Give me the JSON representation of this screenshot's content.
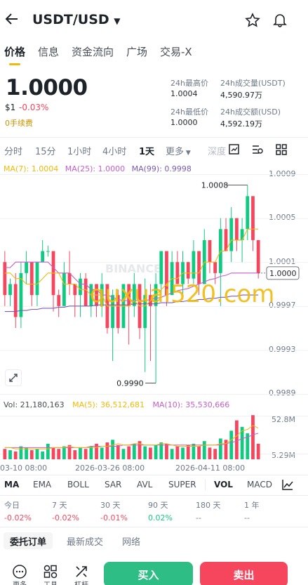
{
  "header": {
    "title": "USDT/USD"
  },
  "tabs": [
    "价格",
    "信息",
    "资金流向",
    "广场",
    "交易-X"
  ],
  "ticker": {
    "price": "1.0000",
    "fiat": "$1",
    "change": "-0.03%",
    "fee": "0手续费",
    "high_label": "24h最高价",
    "high": "1.0004",
    "low_label": "24h最低价",
    "low": "1.0000",
    "vol_label": "24h成交量(USDT)",
    "vol": "4,590.97万",
    "amt_label": "24h成交额(USD)",
    "amt": "4,592.19万"
  },
  "intervals": [
    "分时",
    "15分",
    "1小时",
    "4小时",
    "1天",
    "更多",
    "深度"
  ],
  "ma": {
    "ma7": "MA(7): 1.0004",
    "ma25": "MA(25): 1.0000",
    "ma99": "MA(99): 0.9998"
  },
  "vol_row": {
    "vol": "Vol: 21,180,163",
    "ma5": "MA(5): 36,512,681",
    "ma10": "MA(10): 35,530,666"
  },
  "colors": {
    "up": "#0ecb81",
    "down": "#f6465d",
    "accent": "#f0b90b",
    "ma7": "#f0b90b",
    "ma25": "#c45fc9",
    "ma99": "#7a5bb8"
  },
  "watermark": "BINANCE",
  "overlay_text": "quxuai520.com",
  "chart_data": {
    "type": "candlestick",
    "y_ticks": [
      "1.0009",
      "1.0005",
      "1.0001",
      "0.9997",
      "0.9993",
      "0.9989"
    ],
    "ylim": [
      0.9989,
      1.0009
    ],
    "x_ticks": [
      "03-10 08:00",
      "2026-03-26 08:00",
      "2026-04-11 08:00"
    ],
    "high_label": "1.0008",
    "low_label": "0.9990",
    "last_label": "1.0000",
    "vol_ticks": [
      "52.8M",
      "5.29M"
    ],
    "candles": [
      {
        "o": 1.0001,
        "c": 0.9998,
        "h": 1.0002,
        "l": 0.9997
      },
      {
        "o": 0.9998,
        "c": 0.9999,
        "h": 0.99995,
        "l": 0.9997
      },
      {
        "o": 0.9999,
        "c": 0.9996,
        "h": 1.0,
        "l": 0.9995
      },
      {
        "o": 0.9996,
        "c": 1.0,
        "h": 1.0001,
        "l": 0.9995
      },
      {
        "o": 1.0,
        "c": 1.0001,
        "h": 1.0002,
        "l": 0.9999
      },
      {
        "o": 1.0001,
        "c": 0.9998,
        "h": 1.0001,
        "l": 0.9997
      },
      {
        "o": 0.9998,
        "c": 1.0001,
        "h": 1.0001,
        "l": 0.9997
      },
      {
        "o": 1.0001,
        "c": 1.0002,
        "h": 1.0003,
        "l": 1.0001
      },
      {
        "o": 1.0002,
        "c": 1.0002,
        "h": 1.00025,
        "l": 1.00015
      },
      {
        "o": 1.0002,
        "c": 0.9998,
        "h": 1.0002,
        "l": 0.99965
      },
      {
        "o": 0.9998,
        "c": 0.9997,
        "h": 0.99985,
        "l": 0.9996
      },
      {
        "o": 0.9997,
        "c": 1.0,
        "h": 1.0001,
        "l": 0.9997
      },
      {
        "o": 1.0,
        "c": 0.9999,
        "h": 1.0002,
        "l": 0.9998
      },
      {
        "o": 0.9999,
        "c": 0.9998,
        "h": 0.9999,
        "l": 0.9996
      },
      {
        "o": 0.9998,
        "c": 0.99995,
        "h": 1.0,
        "l": 0.9996
      },
      {
        "o": 0.99995,
        "c": 0.9997,
        "h": 1.0,
        "l": 0.9997
      },
      {
        "o": 0.9997,
        "c": 0.9999,
        "h": 0.9999,
        "l": 0.9996
      },
      {
        "o": 0.9999,
        "c": 0.9997,
        "h": 0.9999,
        "l": 0.9996
      },
      {
        "o": 0.9997,
        "c": 0.9999,
        "h": 1.0,
        "l": 0.9996
      },
      {
        "o": 0.9999,
        "c": 0.9995,
        "h": 0.9999,
        "l": 0.99945
      },
      {
        "o": 0.9995,
        "c": 0.9998,
        "h": 0.99985,
        "l": 0.9992
      },
      {
        "o": 0.9998,
        "c": 0.9995,
        "h": 0.99985,
        "l": 0.99945
      },
      {
        "o": 0.9995,
        "c": 0.9999,
        "h": 0.9999,
        "l": 0.9995
      },
      {
        "o": 0.9999,
        "c": 0.9997,
        "h": 0.9999,
        "l": 0.99935
      },
      {
        "o": 0.9997,
        "c": 0.9999,
        "h": 1.0,
        "l": 0.9996
      },
      {
        "o": 0.9999,
        "c": 0.9995,
        "h": 0.9999,
        "l": 0.9994
      },
      {
        "o": 0.9995,
        "c": 0.9998,
        "h": 0.99995,
        "l": 0.9991
      },
      {
        "o": 0.9998,
        "c": 0.9997,
        "h": 0.9999,
        "l": 0.9992
      },
      {
        "o": 0.9997,
        "c": 0.9999,
        "h": 1.0,
        "l": 0.999
      },
      {
        "o": 0.9999,
        "c": 1.0002,
        "h": 1.0002,
        "l": 0.9998
      },
      {
        "o": 1.0002,
        "c": 0.9998,
        "h": 1.0002,
        "l": 0.9997
      },
      {
        "o": 0.9998,
        "c": 1.0001,
        "h": 1.0002,
        "l": 0.9998
      },
      {
        "o": 1.0001,
        "c": 0.9999,
        "h": 1.0002,
        "l": 0.9999
      },
      {
        "o": 0.9999,
        "c": 1.0001,
        "h": 1.0002,
        "l": 0.9998
      },
      {
        "o": 1.0001,
        "c": 0.99995,
        "h": 1.0001,
        "l": 0.9999
      },
      {
        "o": 0.99995,
        "c": 1.0002,
        "h": 1.0003,
        "l": 0.9999
      },
      {
        "o": 1.0002,
        "c": 0.9999,
        "h": 1.0002,
        "l": 0.9998
      },
      {
        "o": 0.9999,
        "c": 1.0003,
        "h": 1.0004,
        "l": 0.9999
      },
      {
        "o": 1.0003,
        "c": 1.0001,
        "h": 1.0003,
        "l": 1.0
      },
      {
        "o": 1.0001,
        "c": 1.0,
        "h": 1.0001,
        "l": 0.9999
      },
      {
        "o": 1.0,
        "c": 1.0004,
        "h": 1.0005,
        "l": 0.9997
      },
      {
        "o": 1.0004,
        "c": 1.0002,
        "h": 1.0005,
        "l": 1.0002
      },
      {
        "o": 1.0002,
        "c": 1.0005,
        "h": 1.0006,
        "l": 1.0001
      },
      {
        "o": 1.0005,
        "c": 1.0003,
        "h": 1.0005,
        "l": 1.0002
      },
      {
        "o": 1.0003,
        "c": 1.0004,
        "h": 1.0005,
        "l": 1.0001
      },
      {
        "o": 1.0004,
        "c": 1.0007,
        "h": 1.0008,
        "l": 1.0003
      },
      {
        "o": 1.0007,
        "c": 1.0003,
        "h": 1.0007,
        "l": 1.0002
      },
      {
        "o": 1.0003,
        "c": 1.0,
        "h": 1.0003,
        "l": 0.99995
      }
    ],
    "ma7": [
      1.0,
      1.0,
      0.99995,
      0.99995,
      0.9999,
      0.9999,
      0.9999,
      0.99995,
      1.0,
      1.0,
      1.0,
      0.9999,
      0.9999,
      0.9999,
      0.99985,
      0.99985,
      0.9998,
      0.9998,
      0.9998,
      0.9997,
      0.9997,
      0.9997,
      0.9997,
      0.9997,
      0.99975,
      0.9997,
      0.9997,
      0.99975,
      0.9998,
      0.99985,
      0.9999,
      0.99995,
      0.99995,
      1.0,
      1.0,
      1.0,
      1.0,
      1.0001,
      1.0001,
      1.0001,
      1.0002,
      1.0002,
      1.0003,
      1.0003,
      1.0003,
      1.0004,
      1.0004,
      1.0004
    ],
    "ma25": [
      1.00005,
      1.00005,
      1.0001,
      1.0001,
      1.0001,
      1.0001,
      1.0001,
      1.0001,
      1.0001,
      1.00005,
      1.0,
      1.0,
      1.0,
      0.99995,
      0.9999,
      0.9999,
      0.99985,
      0.99985,
      0.9998,
      0.9998,
      0.99978,
      0.99976,
      0.99975,
      0.99975,
      0.99975,
      0.99975,
      0.99975,
      0.99976,
      0.99977,
      0.99978,
      0.9998,
      0.99982,
      0.99984,
      0.99985,
      0.99986,
      0.99988,
      0.9999,
      0.99992,
      0.99994,
      0.99995,
      0.99997,
      0.99998,
      1.0,
      1.0,
      1.0,
      1.0,
      1.0,
      1.0
    ],
    "ma99": [
      0.99965,
      0.99965,
      0.99965,
      0.99966,
      0.99966,
      0.99967,
      0.99967,
      0.99968,
      0.99968,
      0.99968,
      0.99969,
      0.99969,
      0.9997,
      0.9997,
      0.9997,
      0.9997,
      0.9997,
      0.99971,
      0.99971,
      0.99971,
      0.99971,
      0.99971,
      0.99971,
      0.99971,
      0.99972,
      0.99972,
      0.99972,
      0.99972,
      0.99972,
      0.99973,
      0.99973,
      0.99973,
      0.99974,
      0.99974,
      0.99975,
      0.99975,
      0.99976,
      0.99976,
      0.99977,
      0.99977,
      0.99978,
      0.99978,
      0.99979,
      0.99979,
      0.9998,
      0.9998,
      0.9998,
      0.9998
    ],
    "volumes": [
      8,
      7,
      6,
      10,
      9,
      7,
      8,
      6,
      12,
      9,
      8,
      10,
      11,
      7,
      9,
      8,
      10,
      12,
      9,
      13,
      15,
      11,
      8,
      10,
      12,
      14,
      10,
      9,
      11,
      13,
      12,
      8,
      10,
      9,
      11,
      12,
      10,
      14,
      9,
      8,
      16,
      15,
      22,
      30,
      25,
      20,
      34,
      12
    ],
    "vol_ma5": [
      9,
      9,
      8,
      8,
      8,
      8,
      8,
      8,
      8,
      9,
      9,
      9,
      10,
      9,
      9,
      9,
      9,
      9,
      10,
      10,
      11,
      12,
      11,
      11,
      12,
      12,
      11,
      11,
      11,
      12,
      12,
      11,
      10,
      10,
      10,
      10,
      10,
      11,
      11,
      11,
      12,
      12,
      15,
      18,
      22,
      23,
      26,
      24
    ],
    "vol_ma10": [
      9,
      9,
      9,
      9,
      9,
      9,
      9,
      9,
      9,
      9,
      9,
      9,
      9,
      9,
      9,
      9,
      10,
      10,
      10,
      10,
      10,
      10,
      11,
      11,
      11,
      11,
      11,
      11,
      11,
      11,
      11,
      11,
      11,
      11,
      11,
      11,
      11,
      11,
      11,
      11,
      11,
      12,
      13,
      14,
      16,
      17,
      19,
      20
    ]
  },
  "indicators": [
    "MA",
    "EMA",
    "BOLL",
    "SAR",
    "AVL",
    "SUPER",
    "VOL",
    "MACD"
  ],
  "periods": {
    "labels": [
      "今日",
      "7 天",
      "30 天",
      "90 天",
      "180 天",
      "1 年"
    ],
    "values": [
      "-0.02%",
      "-0.02%",
      "-0.01%",
      "0.02%",
      "--",
      "--"
    ]
  },
  "bottom_tabs": [
    "委托订单",
    "最新成交",
    "网络"
  ],
  "bottom_bar": {
    "more": "更多",
    "tools": "工具",
    "leverage": "杠杆",
    "buy": "买入",
    "sell": "卖出"
  }
}
